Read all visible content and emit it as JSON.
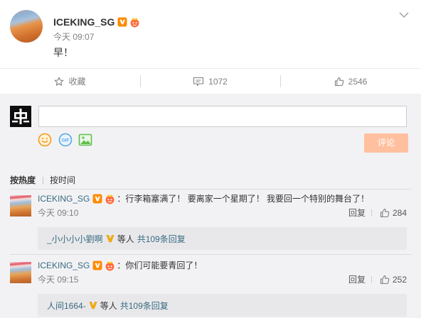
{
  "post": {
    "author": {
      "name": "ICEKING_SG",
      "badges": [
        "verified-v-badge-icon",
        "vip-crown-icon"
      ]
    },
    "time": "今天 09:07",
    "text": "早！",
    "menu_icon": "chevron-down-icon"
  },
  "actions": {
    "favorite": {
      "label": "收藏",
      "icon": "star-icon"
    },
    "comments": {
      "count": "1072",
      "icon": "comment-icon"
    },
    "likes": {
      "count": "2546",
      "icon": "thumb-up-icon"
    }
  },
  "composer": {
    "input_value": "",
    "tools": [
      "emoji-icon",
      "gif-icon",
      "image-icon"
    ],
    "gif_label": "GIF",
    "submit_label": "评论"
  },
  "sort": {
    "options": [
      "按热度",
      "按时间"
    ],
    "selected": 0
  },
  "comments": [
    {
      "author": "ICEKING_SG",
      "badges": [
        "verified-v-badge-icon",
        "vip-crown-icon"
      ],
      "text": "：行李箱塞满了！ 要离家一个星期了！ 我要回一个特别的舞台了！",
      "time": "今天 09:10",
      "reply_label": "回复",
      "likes": "284",
      "reply_summary": {
        "first_replier": "_小小小小劉啊",
        "middle": "等人",
        "count_label": "共109条回复"
      }
    },
    {
      "author": "ICEKING_SG",
      "badges": [
        "verified-v-badge-icon",
        "vip-crown-icon"
      ],
      "text": "：你们可能要青回了！",
      "time": "今天 09:15",
      "reply_label": "回复",
      "likes": "252",
      "reply_summary": {
        "first_replier": "人间1664-",
        "middle": "等人",
        "count_label": "共109条回复"
      }
    }
  ],
  "colors": {
    "link": "#3a6b80",
    "submit_button": "#ffc09f",
    "comment_area_bg": "#f2f2f5",
    "reply_box_bg": "#e8e8eb",
    "verified_badge": "#ff8a00"
  }
}
